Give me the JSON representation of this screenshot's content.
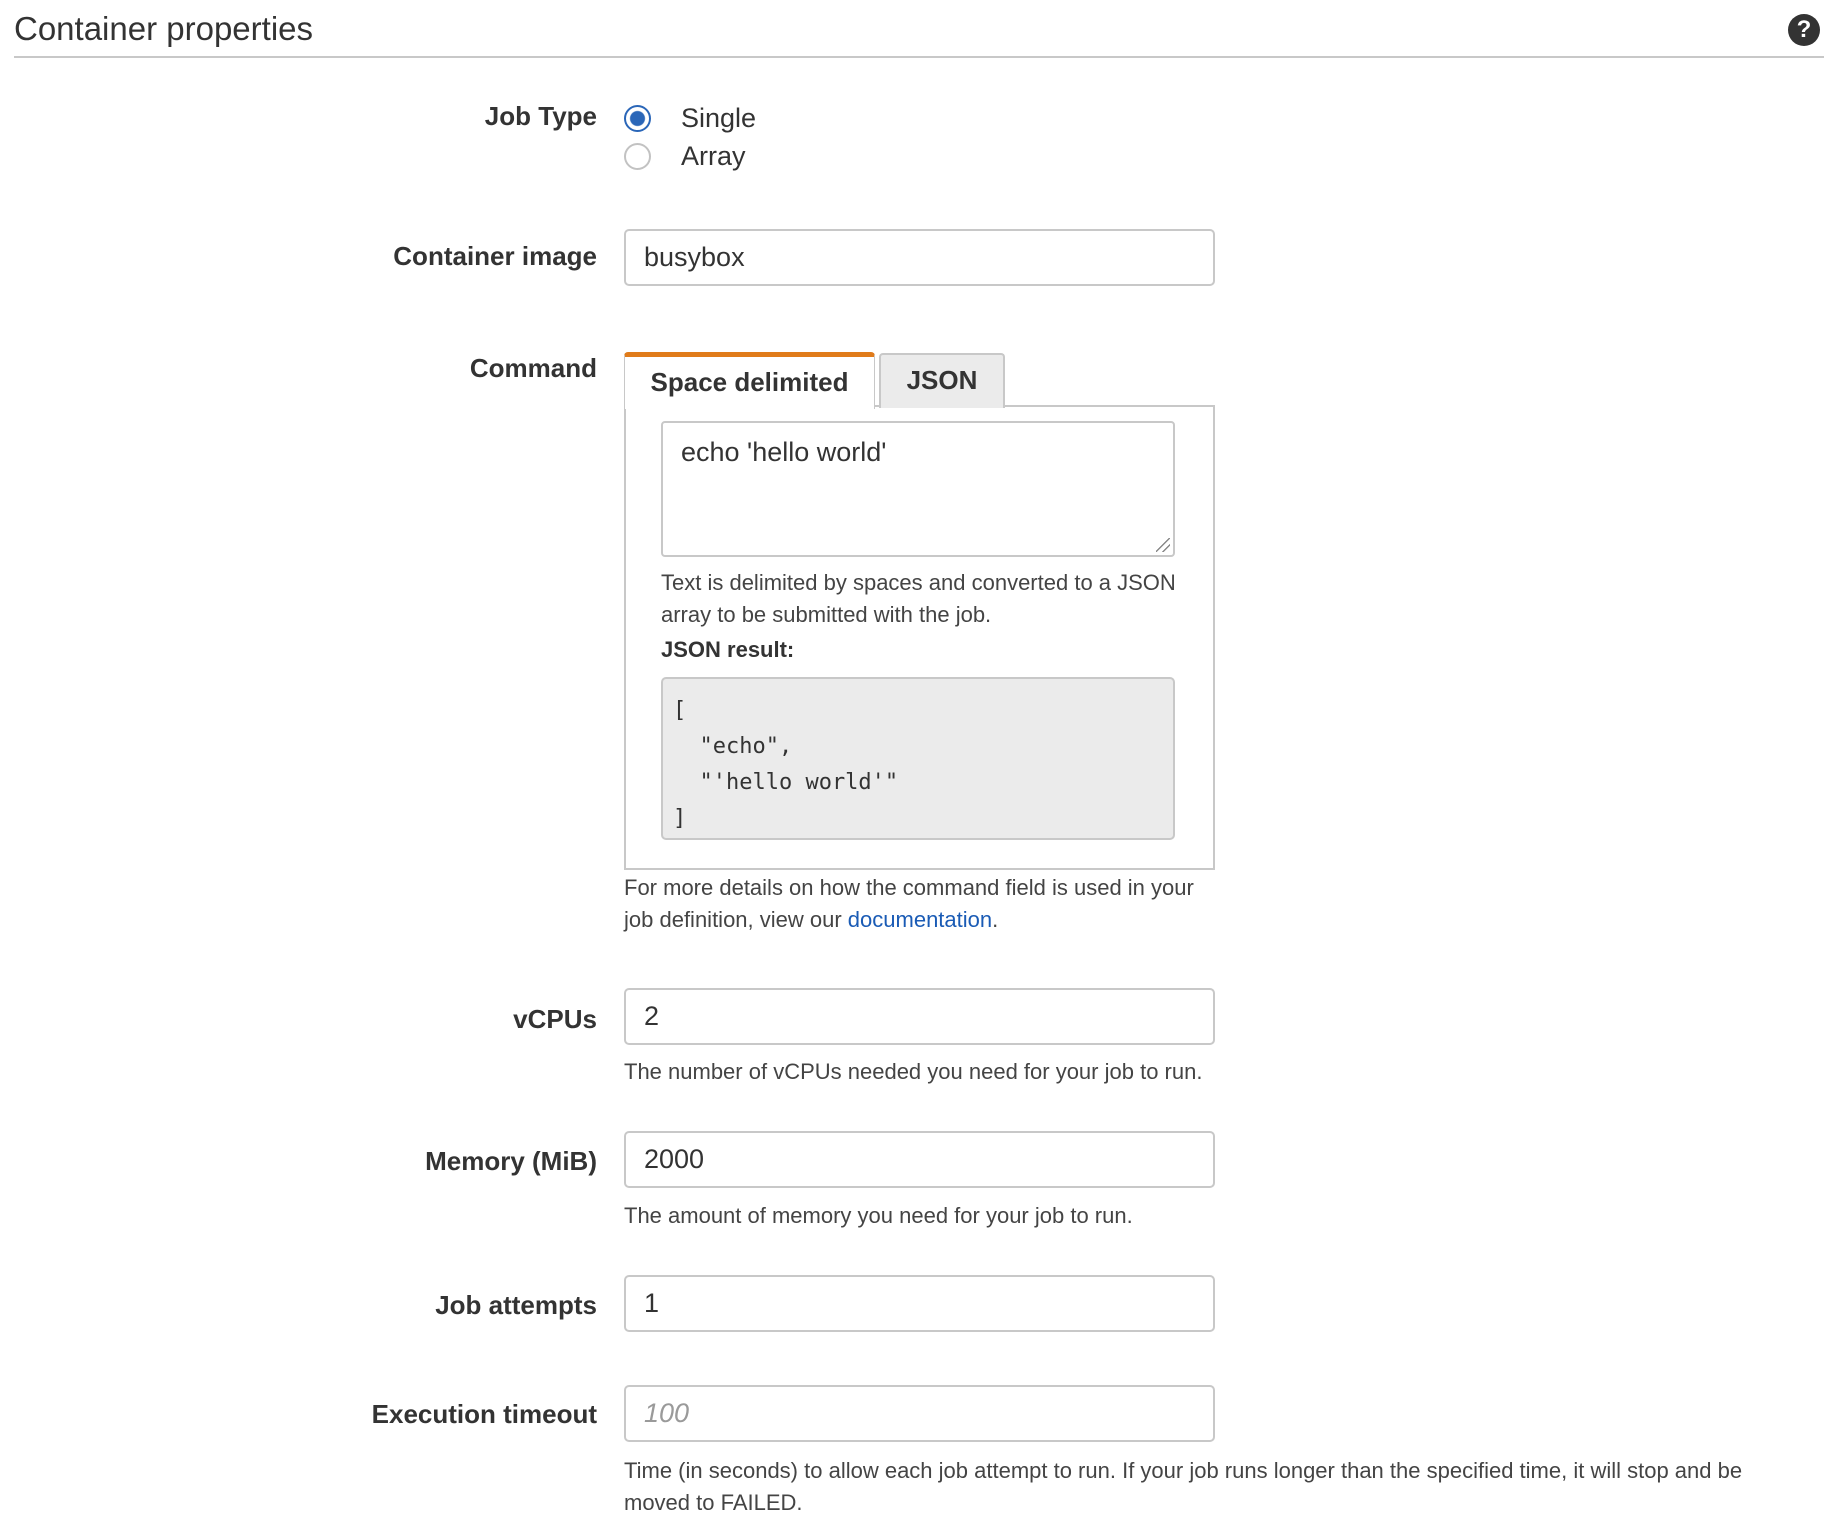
{
  "header": {
    "title": "Container properties",
    "help_icon": "question-circle-icon"
  },
  "job_type": {
    "label": "Job Type",
    "options": [
      {
        "label": "Single",
        "checked": true
      },
      {
        "label": "Array",
        "checked": false
      }
    ]
  },
  "container_image": {
    "label": "Container image",
    "value": "busybox"
  },
  "command": {
    "label": "Command",
    "tabs": [
      {
        "label": "Space delimited",
        "active": true
      },
      {
        "label": "JSON",
        "active": false
      }
    ],
    "value": "echo 'hello world'",
    "helper_line1": "Text is delimited by spaces and converted to a JSON",
    "helper_line2": "array to be submitted with the job.",
    "json_result_label": "JSON result:",
    "json_result_lines": [
      "[",
      "  \"echo\",",
      "  \"'hello world'\"",
      "]"
    ],
    "footer_line1": "For more details on how the command field is used in your",
    "footer_line2_prefix": "job definition, view our ",
    "footer_link": "documentation",
    "footer_line2_suffix": "."
  },
  "vcpus": {
    "label": "vCPUs",
    "value": "2",
    "hint": "The number of vCPUs needed you need for your job to run."
  },
  "memory": {
    "label": "Memory (MiB)",
    "value": "2000",
    "hint": "The amount of memory you need for your job to run."
  },
  "job_attempts": {
    "label": "Job attempts",
    "value": "1"
  },
  "execution_timeout": {
    "label": "Execution timeout",
    "value": "",
    "placeholder": "100",
    "hint_line1": "Time (in seconds) to allow each job attempt to run. If your job runs longer than the specified time, it will stop and be",
    "hint_line2": "moved to FAILED."
  },
  "colors": {
    "accent_tab": "#e07b1a",
    "radio_selected": "#2a66b8",
    "link": "#1a5bb5"
  }
}
